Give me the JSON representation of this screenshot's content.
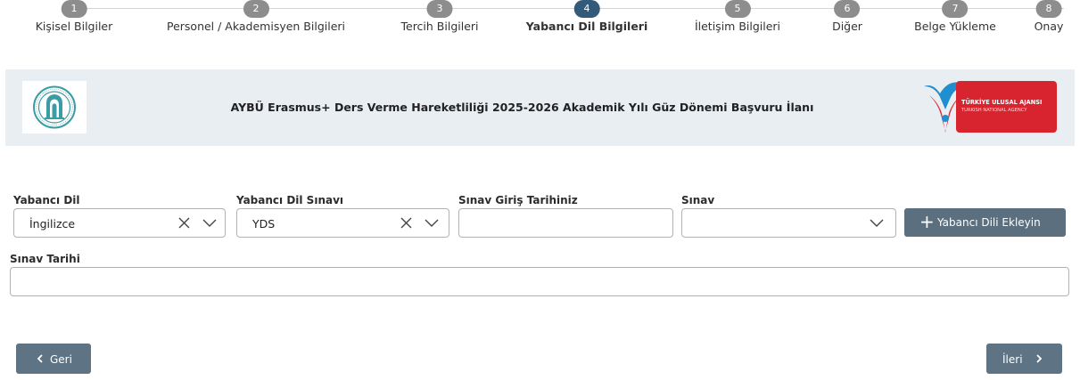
{
  "steps": [
    {
      "number": "1",
      "label": "Kişisel Bilgiler"
    },
    {
      "number": "2",
      "label": "Personel / Akademisyen Bilgileri"
    },
    {
      "number": "3",
      "label": "Tercih Bilgileri"
    },
    {
      "number": "4",
      "label": "Yabancı Dil Bilgileri"
    },
    {
      "number": "5",
      "label": "İletişim Bilgileri"
    },
    {
      "number": "6",
      "label": "Diğer"
    },
    {
      "number": "7",
      "label": "Belge Yükleme"
    },
    {
      "number": "8",
      "label": "Onay"
    }
  ],
  "active_step": 4,
  "banner": {
    "title": "AYBÜ Erasmus+ Ders Verme Hareketliliği 2025-2026 Akademik Yılı Güz Dönemi Başvuru İlanı",
    "right_logo_line1": "TÜRKİYE ULUSAL AJANSI",
    "right_logo_line2": "TURKISH NATIONAL AGENCY"
  },
  "form": {
    "foreign_language": {
      "label": "Yabancı Dil",
      "value": "İngilizce"
    },
    "language_exam": {
      "label": "Yabancı Dil Sınavı",
      "value": "YDS"
    },
    "exam_entry_date": {
      "label": "Sınav Giriş Tarihiniz",
      "value": ""
    },
    "exam": {
      "label": "Sınav",
      "value": ""
    },
    "exam_date": {
      "label": "Sınav Tarihi",
      "value": ""
    },
    "add_language_button": "Yabancı Dili Ekleyin"
  },
  "navigation": {
    "back_label": "Geri",
    "next_label": "İleri"
  },
  "colors": {
    "step_inactive": "#8d8d8d",
    "step_active": "#345a7a",
    "button": "#5b6f7f",
    "banner_bg": "#e9eef3",
    "agency_red": "#d7242e"
  }
}
